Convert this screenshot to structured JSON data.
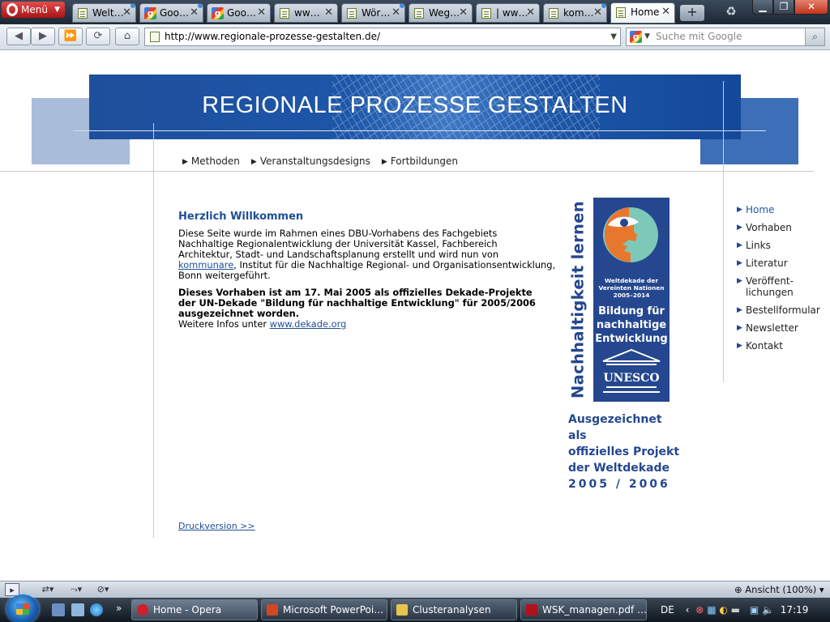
{
  "browser": {
    "menu_label": "Menü",
    "tabs": [
      {
        "label": "Welt…",
        "icon": "page-icon"
      },
      {
        "label": "Goo…",
        "icon": "google-icon"
      },
      {
        "label": "Goo…",
        "icon": "google-icon"
      },
      {
        "label": "ww…",
        "icon": "page-icon"
      },
      {
        "label": "Wör…",
        "icon": "page-icon"
      },
      {
        "label": "Weg…",
        "icon": "page-icon"
      },
      {
        "label": "| ww…",
        "icon": "page-icon"
      },
      {
        "label": "kom…",
        "icon": "page-icon"
      },
      {
        "label": "Home",
        "icon": "page-icon",
        "active": true
      }
    ],
    "url": "http://www.regionale-prozesse-gestalten.de/",
    "search_placeholder": "Suche mit Google"
  },
  "page": {
    "banner_title": "REGIONALE PROZESSE GESTALTEN",
    "top_nav": [
      "Methoden",
      "Veranstaltungsdesigns",
      "Fortbildungen"
    ],
    "welcome_title": "Herzlich Willkommen",
    "intro_line1": "Diese Seite wurde im Rahmen eines DBU-Vorhabens des Fachgebiets",
    "intro_line2": "Nachhaltige Regionalentwicklung der  Universität Kassel, Fachbereich",
    "intro_line3": "Architektur, Stadt- und Landschaftsplanung erstellt und wird nun von",
    "intro_link": "kommunare",
    "intro_line4_rest": ", Institut für die Nachhaltige Regional- und Organisationsentwicklung,",
    "intro_line5": "Bonn weitergeführt.",
    "award_line1": "Dieses Vorhaben ist am 17. Mai 2005 als offizielles Dekade-Projekte",
    "award_line2": "der UN-Dekade \"Bildung für nachhaltige Entwicklung\" für 2005/2006",
    "award_line3": "ausgezeichnet worden.",
    "more_info_prefix": "Weitere Infos unter ",
    "more_info_link": "www.dekade.org",
    "print_link": "Druckversion >>",
    "logo": {
      "vertical_text": "Nachhaltigkeit lernen",
      "small_line1": "Weltdekade der",
      "small_line2": "Vereinten Nationen",
      "small_line3": "2005–2014",
      "big_line1": "Bildung für",
      "big_line2": "nachhaltige",
      "big_line3": "Entwicklung",
      "unesco": "UNESCO",
      "award1": "Ausgezeichnet als",
      "award2": "offizielles Projekt",
      "award3": "der Weltdekade",
      "award_years": "2005 / 2006",
      "colors": {
        "blue": "#24478f",
        "orange": "#e8772e",
        "teal": "#7ec8b8"
      }
    },
    "side_nav": [
      {
        "label": "Home",
        "current": true
      },
      {
        "label": "Vorhaben"
      },
      {
        "label": "Links"
      },
      {
        "label": "Literatur"
      },
      {
        "label": "Veröffent-",
        "label2": "lichungen"
      },
      {
        "label": "Bestellformular"
      },
      {
        "label": "Newsletter"
      },
      {
        "label": "Kontakt"
      }
    ]
  },
  "statusbar": {
    "zoom_label": "Ansicht (100%)"
  },
  "taskbar": {
    "tasks": [
      {
        "label": "Home - Opera",
        "icon": "opera-icon",
        "active": true
      },
      {
        "label": "Microsoft PowerPoi…",
        "icon": "powerpoint-icon"
      },
      {
        "label": "Clusteranalysen",
        "icon": "folder-icon"
      },
      {
        "label": "WSK_managen.pdf …",
        "icon": "pdf-icon"
      }
    ],
    "language": "DE",
    "clock": "17:19"
  }
}
